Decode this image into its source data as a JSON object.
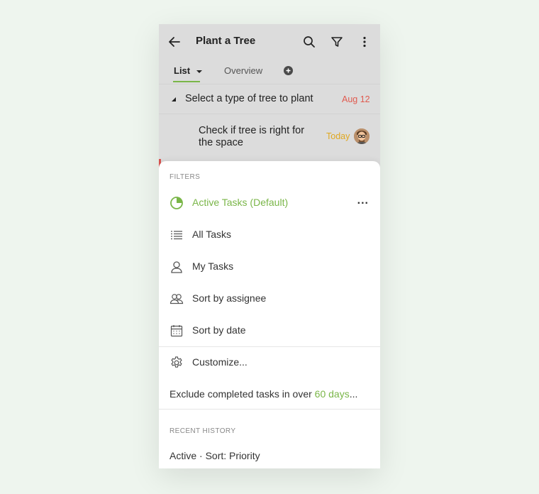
{
  "header": {
    "title": "Plant a Tree",
    "back_icon": "back-arrow-icon",
    "search_icon": "search-icon",
    "filter_icon": "filter-icon",
    "more_icon": "more-vertical-icon"
  },
  "tabs": {
    "list_label": "List",
    "overview_label": "Overview",
    "add_icon": "add-circle-icon"
  },
  "tasks": [
    {
      "title": "Select a type of tree to plant",
      "due": "Aug 12",
      "due_color": "#e05a4f"
    },
    {
      "title_line1": "Check if tree is right for",
      "title_line2": "the space",
      "due": "Today",
      "due_color": "#e0a820"
    }
  ],
  "filters": {
    "section_label": "FILTERS",
    "items": [
      {
        "label": "Active Tasks (Default)",
        "icon": "pie-chart-icon",
        "active": true
      },
      {
        "label": "All Tasks",
        "icon": "list-icon"
      },
      {
        "label": "My Tasks",
        "icon": "person-icon"
      },
      {
        "label": "Sort by assignee",
        "icon": "people-icon"
      },
      {
        "label": "Sort by date",
        "icon": "calendar-icon"
      }
    ],
    "more_label": "..."
  },
  "customize": {
    "label": "Customize...",
    "icon": "gear-icon"
  },
  "exclude": {
    "prefix": "Exclude completed tasks in over ",
    "days": "60 days",
    "suffix": "..."
  },
  "recent": {
    "section_label": "RECENT HISTORY",
    "item": "Active · Sort: Priority"
  },
  "colors": {
    "accent": "#7ab648",
    "overdue": "#e05a4f",
    "today": "#e0a820"
  }
}
